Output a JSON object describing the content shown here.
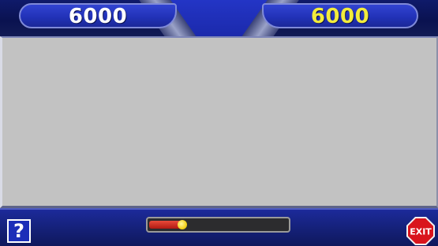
{
  "scores": {
    "left": "6000",
    "right": "6000"
  },
  "colors": {
    "left_score": "#ffffff",
    "right_score": "#f2ec3c",
    "panel": "#c2c2c2",
    "bar_blue": "#1c2a9a",
    "exit_red": "#d9141c"
  },
  "controls": {
    "help_label": "?",
    "exit_label": "EXIT",
    "help_icon": "question-mark-icon",
    "exit_icon": "stop-sign-exit-icon"
  },
  "timer": {
    "progress": 0.24
  }
}
